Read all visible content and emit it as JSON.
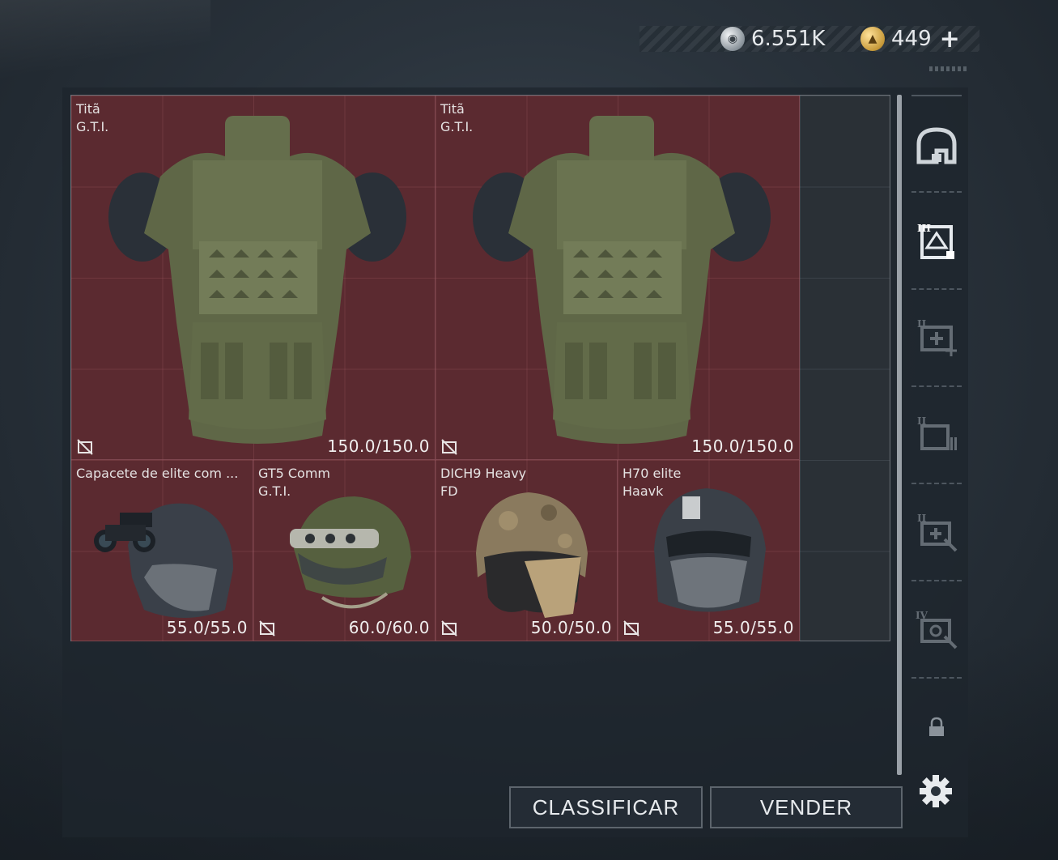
{
  "currency": {
    "silver_amount": "6.551K",
    "gold_amount": "449",
    "add_symbol": "+",
    "silver_icon": "silver-coin-icon",
    "gold_icon": "gold-coin-icon"
  },
  "inventory": {
    "items": [
      {
        "name": "Titã",
        "sub": "G.T.I.",
        "durability": "150.0/150.0",
        "kind": "vest"
      },
      {
        "name": "Titã",
        "sub": "G.T.I.",
        "durability": "150.0/150.0",
        "kind": "vest"
      },
      {
        "name": "Capacete de elite com ...",
        "sub": "",
        "durability": "55.0/55.0",
        "kind": "helmet-nvg"
      },
      {
        "name": "GT5 Comm",
        "sub": "G.T.I.",
        "durability": "60.0/60.0",
        "kind": "helmet-comm"
      },
      {
        "name": "DICH9 Heavy",
        "sub": "FD",
        "durability": "50.0/50.0",
        "kind": "helmet-camo"
      },
      {
        "name": "H70 elite",
        "sub": "Haavk",
        "durability": "55.0/55.0",
        "kind": "helmet-mask"
      }
    ]
  },
  "side_tabs": [
    {
      "icon": "backpack-icon",
      "roman": ""
    },
    {
      "icon": "armor-vest-icon",
      "roman": "III"
    },
    {
      "icon": "medkit-icon",
      "roman": "II"
    },
    {
      "icon": "ammo-box-icon",
      "roman": "II"
    },
    {
      "icon": "repair-kit-icon",
      "roman": "II"
    },
    {
      "icon": "repair-kit-icon",
      "roman": "IV"
    },
    {
      "icon": "lock-icon",
      "roman": ""
    }
  ],
  "buttons": {
    "sort_label": "CLASSIFICAR",
    "sell_label": "VENDER"
  },
  "colors": {
    "item_bg": "#5b2a30",
    "panel_bg": "#1e252d"
  }
}
